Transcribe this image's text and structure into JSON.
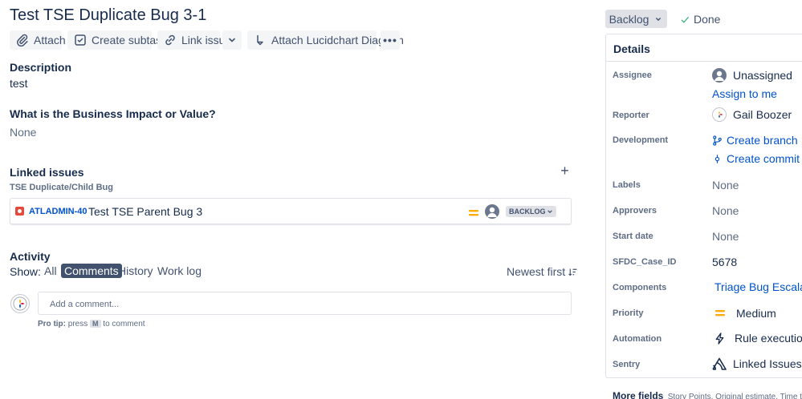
{
  "issue": {
    "title": "Test TSE Duplicate Bug 3-1"
  },
  "toolbar": {
    "attach": "Attach",
    "create_subtask": "Create subtask",
    "link_issue": "Link issue",
    "lucidchart": "Attach Lucidchart Diagram"
  },
  "description": {
    "heading": "Description",
    "text": "test"
  },
  "business_impact": {
    "heading": "What is the Business Impact or Value?",
    "text": "None"
  },
  "linked_issues": {
    "heading": "Linked issues",
    "relation": "TSE Duplicate/Child Bug",
    "items": [
      {
        "key": "ATLADMIN-40",
        "summary": "Test TSE Parent Bug 3",
        "status": "BACKLOG"
      }
    ]
  },
  "activity": {
    "heading": "Activity",
    "show_label": "Show:",
    "tabs": [
      "All",
      "Comments",
      "History",
      "Work log"
    ],
    "selected_tab": "Comments",
    "sort": "Newest first",
    "comment_placeholder": "Add a comment...",
    "pro_tip_label": "Pro tip:",
    "pro_tip_press": "press",
    "pro_tip_key": "M",
    "pro_tip_rest": "to comment"
  },
  "status": {
    "current": "Backlog",
    "transition": "Done"
  },
  "details": {
    "heading": "Details",
    "assignee": {
      "label": "Assignee",
      "value": "Unassigned",
      "assign_link": "Assign to me"
    },
    "reporter": {
      "label": "Reporter",
      "value": "Gail Boozer"
    },
    "development": {
      "label": "Development",
      "create_branch": "Create branch",
      "create_commit": "Create commit"
    },
    "labels": {
      "label": "Labels",
      "value": "None"
    },
    "approvers": {
      "label": "Approvers",
      "value": "None"
    },
    "start_date": {
      "label": "Start date",
      "value": "None"
    },
    "sfdc_case_id": {
      "label": "SFDC_Case_ID",
      "value": "5678"
    },
    "components": {
      "label": "Components",
      "value": "Triage Bug Escalations"
    },
    "priority": {
      "label": "Priority",
      "value": "Medium"
    },
    "automation": {
      "label": "Automation",
      "value": "Rule executions"
    },
    "sentry": {
      "label": "Sentry",
      "value": "Linked Issues"
    }
  },
  "more_fields": {
    "label": "More fields",
    "hint": "Story Points, Original estimate, Time tracking"
  },
  "colors": {
    "primary_link": "#0052cc",
    "text": "#172b4d",
    "bug": "#e5493a",
    "priority_medium": "#ffab00"
  }
}
